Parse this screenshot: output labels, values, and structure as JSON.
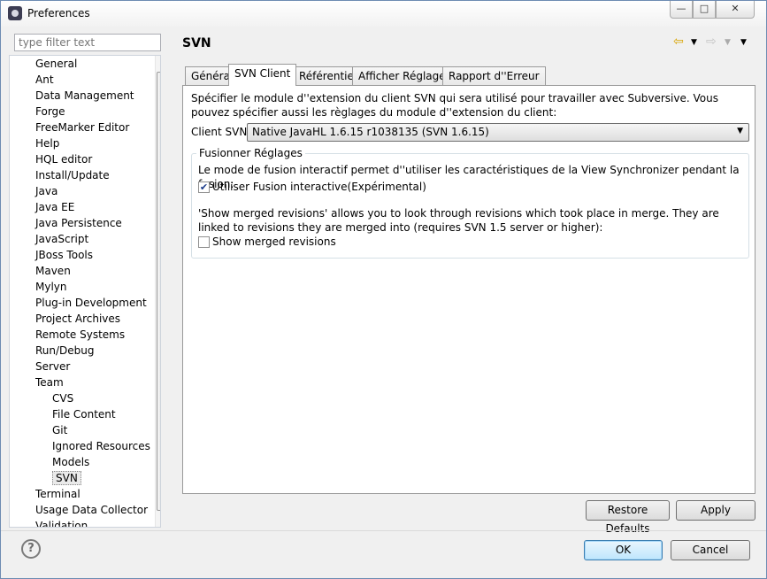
{
  "window": {
    "title": "Preferences",
    "controls": {
      "minimize": "—",
      "maximize": "□",
      "close": "✕"
    }
  },
  "filter": {
    "placeholder": "type filter text"
  },
  "tree": {
    "items": [
      {
        "label": "General",
        "level": 0
      },
      {
        "label": "Ant",
        "level": 0
      },
      {
        "label": "Data Management",
        "level": 0
      },
      {
        "label": "Forge",
        "level": 0
      },
      {
        "label": "FreeMarker Editor",
        "level": 0
      },
      {
        "label": "Help",
        "level": 0
      },
      {
        "label": "HQL editor",
        "level": 0
      },
      {
        "label": "Install/Update",
        "level": 0
      },
      {
        "label": "Java",
        "level": 0
      },
      {
        "label": "Java EE",
        "level": 0
      },
      {
        "label": "Java Persistence",
        "level": 0
      },
      {
        "label": "JavaScript",
        "level": 0
      },
      {
        "label": "JBoss Tools",
        "level": 0
      },
      {
        "label": "Maven",
        "level": 0
      },
      {
        "label": "Mylyn",
        "level": 0
      },
      {
        "label": "Plug-in Development",
        "level": 0
      },
      {
        "label": "Project Archives",
        "level": 0
      },
      {
        "label": "Remote Systems",
        "level": 0
      },
      {
        "label": "Run/Debug",
        "level": 0
      },
      {
        "label": "Server",
        "level": 0
      },
      {
        "label": "Team",
        "level": 0
      },
      {
        "label": "CVS",
        "level": 1
      },
      {
        "label": "File Content",
        "level": 1
      },
      {
        "label": "Git",
        "level": 1
      },
      {
        "label": "Ignored Resources",
        "level": 1
      },
      {
        "label": "Models",
        "level": 1
      },
      {
        "label": "SVN",
        "level": 1,
        "selected": true
      },
      {
        "label": "Terminal",
        "level": 0
      },
      {
        "label": "Usage Data Collector",
        "level": 0
      },
      {
        "label": "Validation",
        "level": 0
      }
    ]
  },
  "page": {
    "title": "SVN",
    "tabs": [
      "Général",
      "SVN Client",
      "Référentiel",
      "Afficher Réglages",
      "Rapport d''Erreur"
    ],
    "active_tab": "SVN Client",
    "description": "Spécifier le module d''extension du client SVN qui sera utilisé pour travailler avec Subversive. Vous pouvez spécifier aussi les règlages du module d''extension du client:",
    "client_label": "Client SVN:",
    "client_value": "Native JavaHL 1.6.15 r1038135 (SVN 1.6.15)",
    "group": {
      "title": "Fusionner Réglages",
      "merge_text": "Le mode de fusion interactif permet d''utiliser les caractéristiques de la View Synchronizer pendant la fusion:",
      "interactive_label": "Utiliser Fusion interactive(Expérimental)",
      "interactive_checked": true,
      "revisions_text": "'Show merged revisions' allows you to look through revisions which took place in merge. They are linked to revisions they are merged into (requires SVN 1.5 server or higher):",
      "show_merged_label": "Show merged revisions",
      "show_merged_checked": false
    }
  },
  "buttons": {
    "restore_defaults": "Restore Defaults",
    "apply": "Apply",
    "ok": "OK",
    "cancel": "Cancel",
    "help": "?"
  }
}
